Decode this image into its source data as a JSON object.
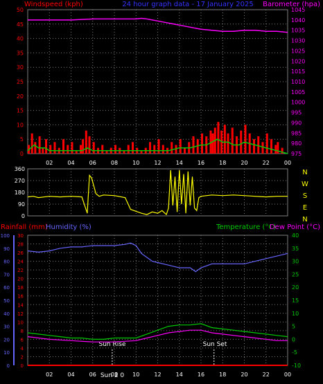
{
  "colors": {
    "background": "#000000",
    "frame": "#808080",
    "grid": "#808080",
    "wind": "#ff0000",
    "wind_avg": "#00cc00",
    "wind_fill": "#ffffff",
    "barometer": "#ff00ff",
    "direction": "#ffff00",
    "rain": "#ff0000",
    "humidity": "#6666ff",
    "temperature": "#00cc00",
    "dewpoint": "#ff00ff",
    "title": "#3333ff",
    "time_axis": "#ffffff",
    "sun": "#ffffff"
  },
  "chart_data": [
    {
      "type": "line",
      "panel": "wind-barometer",
      "title": "24 hour graph data - 17 January 2025",
      "left_axis_label": "Windspeed (kph)",
      "right_axis_label": "Barometer (hpa)",
      "x_ticks": [
        "02",
        "04",
        "06",
        "08",
        "10",
        "12",
        "14",
        "16",
        "18",
        "20",
        "22",
        "00"
      ],
      "xlim": [
        0,
        24
      ],
      "ylim_left": [
        0,
        50
      ],
      "ylim_right": [
        975,
        1045
      ],
      "left_ticks": [
        0,
        5,
        10,
        15,
        20,
        25,
        30,
        35,
        40,
        45,
        50
      ],
      "right_ticks": [
        975,
        980,
        985,
        990,
        995,
        1000,
        1005,
        1010,
        1015,
        1020,
        1025,
        1030,
        1035,
        1040,
        1045
      ],
      "grid": true,
      "series": [
        {
          "name": "Barometer (hpa)",
          "axis": "right",
          "color": "#ff00ff",
          "x": [
            0,
            2,
            4,
            6,
            8,
            10,
            10.5,
            11,
            12,
            13,
            14,
            15,
            16,
            17,
            18,
            19,
            20,
            21,
            22,
            23,
            24
          ],
          "y": [
            1040,
            1040,
            1040,
            1040.5,
            1040.5,
            1040.5,
            1040.8,
            1040.5,
            1039.5,
            1038.5,
            1037.5,
            1036.5,
            1035.5,
            1035,
            1034.5,
            1034.5,
            1035,
            1035,
            1034.5,
            1034.5,
            1034
          ]
        },
        {
          "name": "Wind gust",
          "axis": "left",
          "color": "#ff0000",
          "x": [
            0,
            0.3,
            0.6,
            1,
            1.3,
            1.6,
            2,
            2.4,
            2.8,
            3.2,
            3.6,
            4,
            4.4,
            4.8,
            5,
            5.3,
            5.6,
            6,
            6.4,
            6.8,
            7.2,
            7.6,
            8,
            8.4,
            8.8,
            9.2,
            9.6,
            10,
            10.4,
            10.8,
            11.2,
            11.6,
            12,
            12.4,
            12.8,
            13.2,
            13.6,
            14,
            14.4,
            14.8,
            15.2,
            15.6,
            16,
            16.4,
            16.8,
            17,
            17.2,
            17.5,
            17.8,
            18.1,
            18.4,
            18.8,
            19.2,
            19.6,
            20,
            20.4,
            20.8,
            21.2,
            21.6,
            22,
            22.4,
            22.8,
            23,
            23.4,
            23.8
          ],
          "y": [
            3,
            7,
            4,
            6,
            2,
            5,
            3,
            4,
            2,
            5,
            3,
            4,
            1,
            3,
            5,
            8,
            6,
            4,
            2,
            3,
            1,
            2,
            3,
            2,
            1,
            3,
            4,
            2,
            1,
            2,
            4,
            3,
            5,
            3,
            2,
            4,
            3,
            5,
            2,
            4,
            6,
            5,
            7,
            6,
            8,
            7,
            9,
            11,
            8,
            10,
            7,
            9,
            6,
            8,
            10,
            7,
            5,
            6,
            4,
            7,
            5,
            3,
            4,
            2,
            0
          ]
        },
        {
          "name": "Wind average",
          "axis": "left",
          "color": "#00cc00",
          "x": [
            0,
            0.6,
            1,
            1.6,
            2,
            3,
            4,
            5,
            5.5,
            6,
            7,
            8,
            9,
            10,
            11,
            12,
            13,
            14,
            15,
            16,
            16.5,
            17,
            17.5,
            18,
            18.5,
            19,
            19.5,
            20,
            21,
            22,
            23,
            24
          ],
          "y": [
            1,
            3,
            2,
            2,
            1,
            1,
            1,
            1,
            2,
            1,
            1,
            1,
            1,
            1,
            1,
            1,
            1,
            2,
            2,
            3,
            3,
            4,
            5,
            4,
            4,
            3,
            3,
            4,
            3,
            2,
            1,
            0
          ]
        }
      ]
    },
    {
      "type": "scatter",
      "panel": "wind-direction",
      "ylim": [
        0,
        360
      ],
      "left_ticks": [
        0,
        90,
        180,
        270,
        360
      ],
      "compass_labels": [
        "N",
        "W",
        "S",
        "E",
        "N"
      ],
      "grid": true,
      "series": [
        {
          "name": "Wind direction",
          "color": "#ffff00",
          "x": [
            0,
            0.5,
            1,
            2,
            3,
            4,
            5,
            5.5,
            5.7,
            5.9,
            6.1,
            6.3,
            6.6,
            7,
            8,
            9,
            9.5,
            10,
            10.5,
            11,
            11.5,
            12,
            12.4,
            12.8,
            13,
            13.2,
            13.4,
            13.6,
            13.8,
            14,
            14.2,
            14.4,
            14.6,
            14.8,
            15,
            15.2,
            15.4,
            15.6,
            15.8,
            16,
            17,
            18,
            19,
            20,
            21,
            22,
            23,
            24
          ],
          "y": [
            145,
            150,
            140,
            150,
            145,
            150,
            145,
            20,
            310,
            290,
            230,
            170,
            150,
            160,
            155,
            140,
            50,
            35,
            20,
            10,
            30,
            20,
            40,
            10,
            60,
            350,
            80,
            300,
            30,
            350,
            90,
            320,
            20,
            340,
            80,
            300,
            60,
            40,
            140,
            150,
            160,
            155,
            160,
            155,
            150,
            145,
            150,
            150
          ]
        }
      ]
    },
    {
      "type": "line",
      "panel": "rain-humidity-temperature",
      "left_axis_labels": [
        "Rainfall (mm)",
        "Humidity (%)"
      ],
      "right_axis_labels": [
        "Temperature (°C)",
        "Dew Point (°C)"
      ],
      "rain_ticks": [
        0,
        2,
        4,
        6,
        8,
        10,
        12,
        14,
        16,
        18,
        20,
        22,
        24,
        26,
        28,
        30
      ],
      "humidity_ticks": [
        0,
        10,
        20,
        30,
        40,
        50,
        60,
        70,
        80,
        90,
        100
      ],
      "temperature_ticks": [
        -10,
        -5,
        0,
        5,
        10,
        15,
        20,
        25,
        30,
        35,
        40
      ],
      "ylim_rain": [
        0,
        30
      ],
      "ylim_humidity": [
        0,
        100
      ],
      "ylim_temperature": [
        -10,
        40
      ],
      "grid": true,
      "annotations": [
        {
          "label": "Sun Rise",
          "x": 7.8
        },
        {
          "label": "Sun Set",
          "x": 17.2
        },
        {
          "label": "Sun 2 0"
        }
      ],
      "series": [
        {
          "name": "Humidity (%)",
          "color": "#6666ff",
          "axis": "humidity",
          "x": [
            0,
            1,
            2,
            3,
            4,
            5,
            6,
            7,
            8,
            9,
            9.5,
            10,
            10.5,
            11,
            11.5,
            12,
            13,
            14,
            15,
            15.5,
            16,
            17,
            18,
            19,
            20,
            21,
            22,
            23,
            24
          ],
          "y": [
            88,
            87,
            88,
            90,
            91,
            91,
            92,
            92,
            92,
            93,
            94,
            92,
            86,
            83,
            80,
            79,
            77,
            75,
            75,
            72,
            75,
            78,
            78,
            78,
            78,
            80,
            82,
            84,
            86
          ]
        },
        {
          "name": "Temperature (°C)",
          "color": "#00cc00",
          "axis": "temperature",
          "x": [
            0,
            1,
            2,
            3,
            4,
            5,
            6,
            7,
            8,
            9,
            10,
            11,
            12,
            13,
            14,
            15,
            16,
            17,
            18,
            19,
            20,
            21,
            22,
            23,
            24
          ],
          "y": [
            2.5,
            2,
            1.5,
            1,
            0.5,
            0.5,
            0,
            0,
            0.5,
            0.5,
            0.5,
            2,
            3.5,
            5,
            5.5,
            5.5,
            6,
            4.5,
            4,
            3.5,
            3,
            2.5,
            2,
            1.5,
            1
          ]
        },
        {
          "name": "Dew Point (°C)",
          "color": "#ff00ff",
          "axis": "temperature",
          "x": [
            0,
            2,
            4,
            6,
            8,
            10,
            11,
            12,
            13,
            14,
            15,
            16,
            17,
            18,
            19,
            20,
            21,
            22,
            23,
            24
          ],
          "y": [
            1,
            0,
            -0.5,
            -1,
            -1,
            -0.5,
            0.5,
            1.5,
            2.5,
            3,
            3.5,
            3.5,
            2.5,
            2,
            1.5,
            1,
            0.5,
            0,
            -0.5,
            -0.5
          ]
        },
        {
          "name": "Rainfall (mm)",
          "color": "#ff0000",
          "axis": "rain",
          "x": [
            0,
            24
          ],
          "y": [
            0,
            0
          ]
        }
      ]
    }
  ]
}
